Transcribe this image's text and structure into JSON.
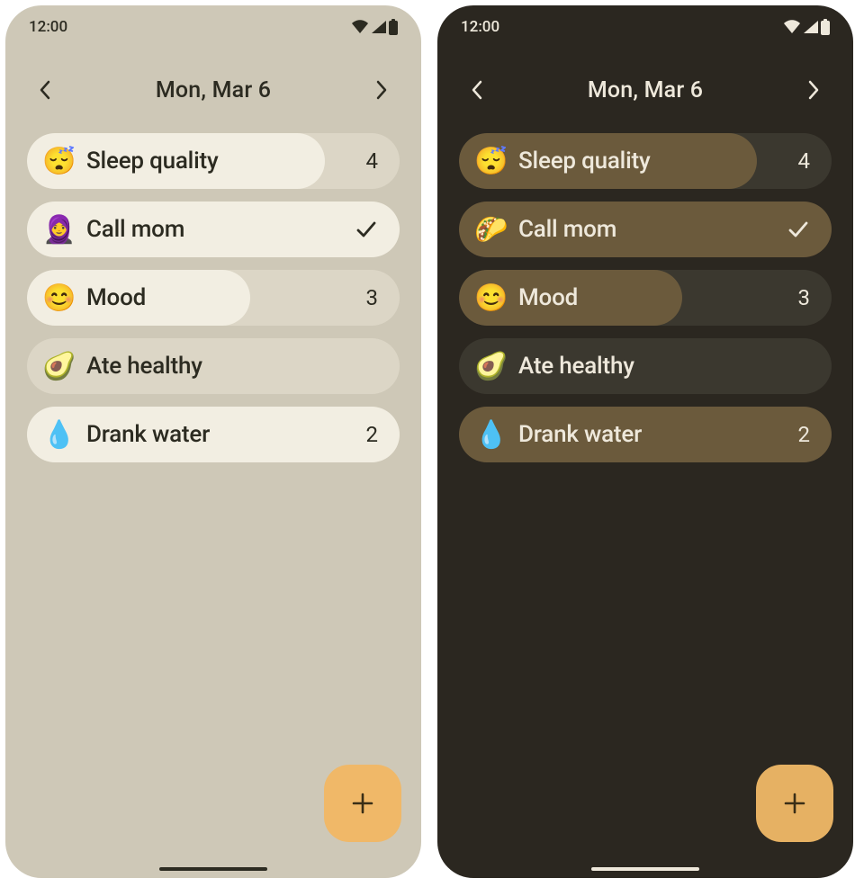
{
  "status_time": "12:00",
  "date_title": "Mon, Mar 6",
  "fab_icon": "plus-icon",
  "themes": {
    "light": {
      "bg": "#cec8b7",
      "item_bg": "#dcd6c6",
      "item_fill": "#f2eee2",
      "text": "#2c2b21",
      "fab": "#f0b868"
    },
    "dark": {
      "bg": "#2b2720",
      "item_bg": "#3b382f",
      "item_fill": "#6b5a3c",
      "text": "#eee8db",
      "fab": "#e6b163"
    }
  },
  "panels": [
    {
      "theme": "light",
      "items": [
        {
          "emoji": "😴",
          "label": "Sleep quality",
          "type": "scale",
          "value": "4",
          "fill_pct": 80
        },
        {
          "emoji": "🧕",
          "label": "Call mom",
          "type": "check",
          "checked": true,
          "fill_pct": 100
        },
        {
          "emoji": "😊",
          "label": "Mood",
          "type": "scale",
          "value": "3",
          "fill_pct": 60
        },
        {
          "emoji": "🥑",
          "label": "Ate healthy",
          "type": "check",
          "checked": false,
          "fill_pct": 0
        },
        {
          "emoji": "💧",
          "label": "Drank water",
          "type": "count",
          "value": "2",
          "fill_pct": 100
        }
      ]
    },
    {
      "theme": "dark",
      "items": [
        {
          "emoji": "😴",
          "label": "Sleep quality",
          "type": "scale",
          "value": "4",
          "fill_pct": 80
        },
        {
          "emoji": "🌮",
          "label": "Call mom",
          "type": "check",
          "checked": true,
          "fill_pct": 100
        },
        {
          "emoji": "😊",
          "label": "Mood",
          "type": "scale",
          "value": "3",
          "fill_pct": 60
        },
        {
          "emoji": "🥑",
          "label": "Ate healthy",
          "type": "check",
          "checked": false,
          "fill_pct": 0
        },
        {
          "emoji": "💧",
          "label": "Drank water",
          "type": "count",
          "value": "2",
          "fill_pct": 100
        }
      ]
    }
  ]
}
